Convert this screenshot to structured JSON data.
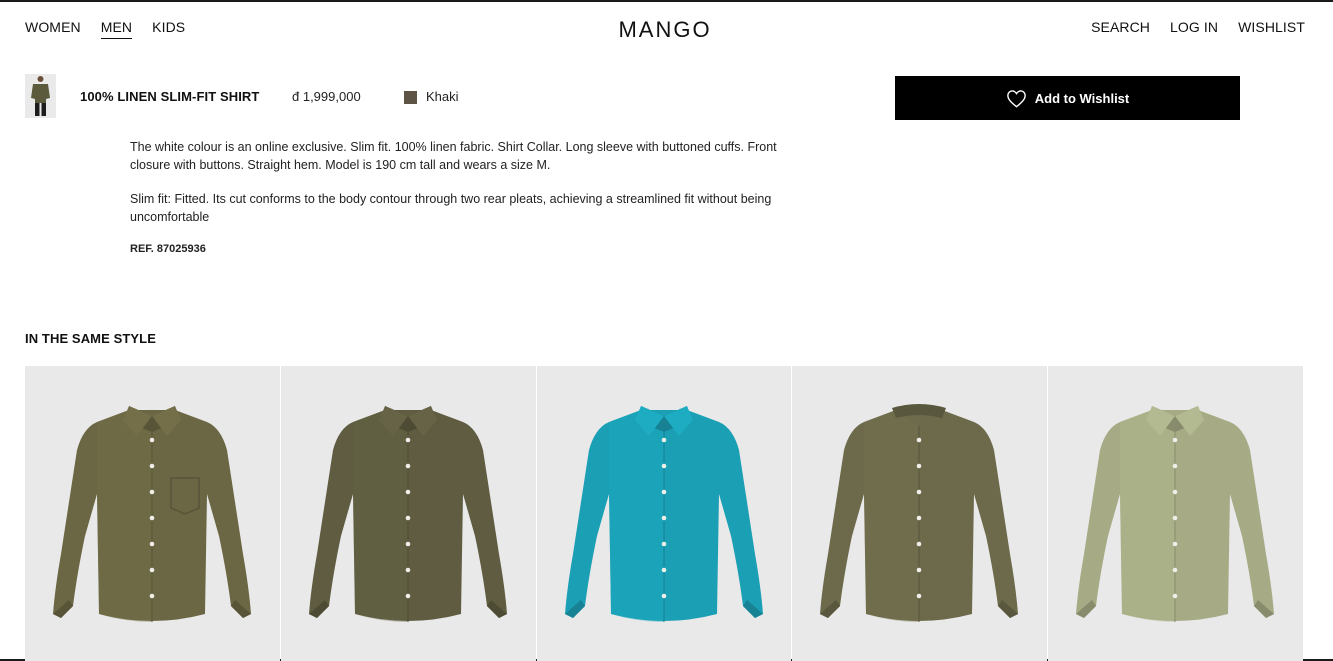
{
  "header": {
    "nav_left": [
      "WOMEN",
      "MEN",
      "KIDS"
    ],
    "logo": "MANGO",
    "nav_right": [
      "SEARCH",
      "LOG IN",
      "WISHLIST"
    ]
  },
  "product": {
    "name": "100% LINEN SLIM-FIT SHIRT",
    "price": "đ 1,999,000",
    "color_name": "Khaki",
    "color_hex": "#5e5445",
    "wishlist_label": "Add to Wishlist"
  },
  "description": {
    "paragraph1": "The white colour is an online exclusive. Slim fit. 100% linen fabric. Shirt Collar. Long sleeve with buttoned cuffs. Front closure with buttons. Straight hem. Model is 190 cm tall and wears a size M.",
    "paragraph2": "Slim fit: Fitted. Its cut conforms to the body contour through two rear pleats, achieving a streamlined fit without being uncomfortable",
    "ref": "REF. 87025936"
  },
  "same_style": {
    "title": "IN THE SAME STYLE",
    "items": [
      {
        "color": "#6b6744",
        "collar": "classic",
        "pocket": true
      },
      {
        "color": "#5f5c41",
        "collar": "classic",
        "pocket": false
      },
      {
        "color": "#1b9fb4",
        "collar": "classic",
        "pocket": false
      },
      {
        "color": "#6c6a4b",
        "collar": "mandarin",
        "pocket": false
      },
      {
        "color": "#a6ab85",
        "collar": "classic",
        "pocket": false
      }
    ]
  }
}
